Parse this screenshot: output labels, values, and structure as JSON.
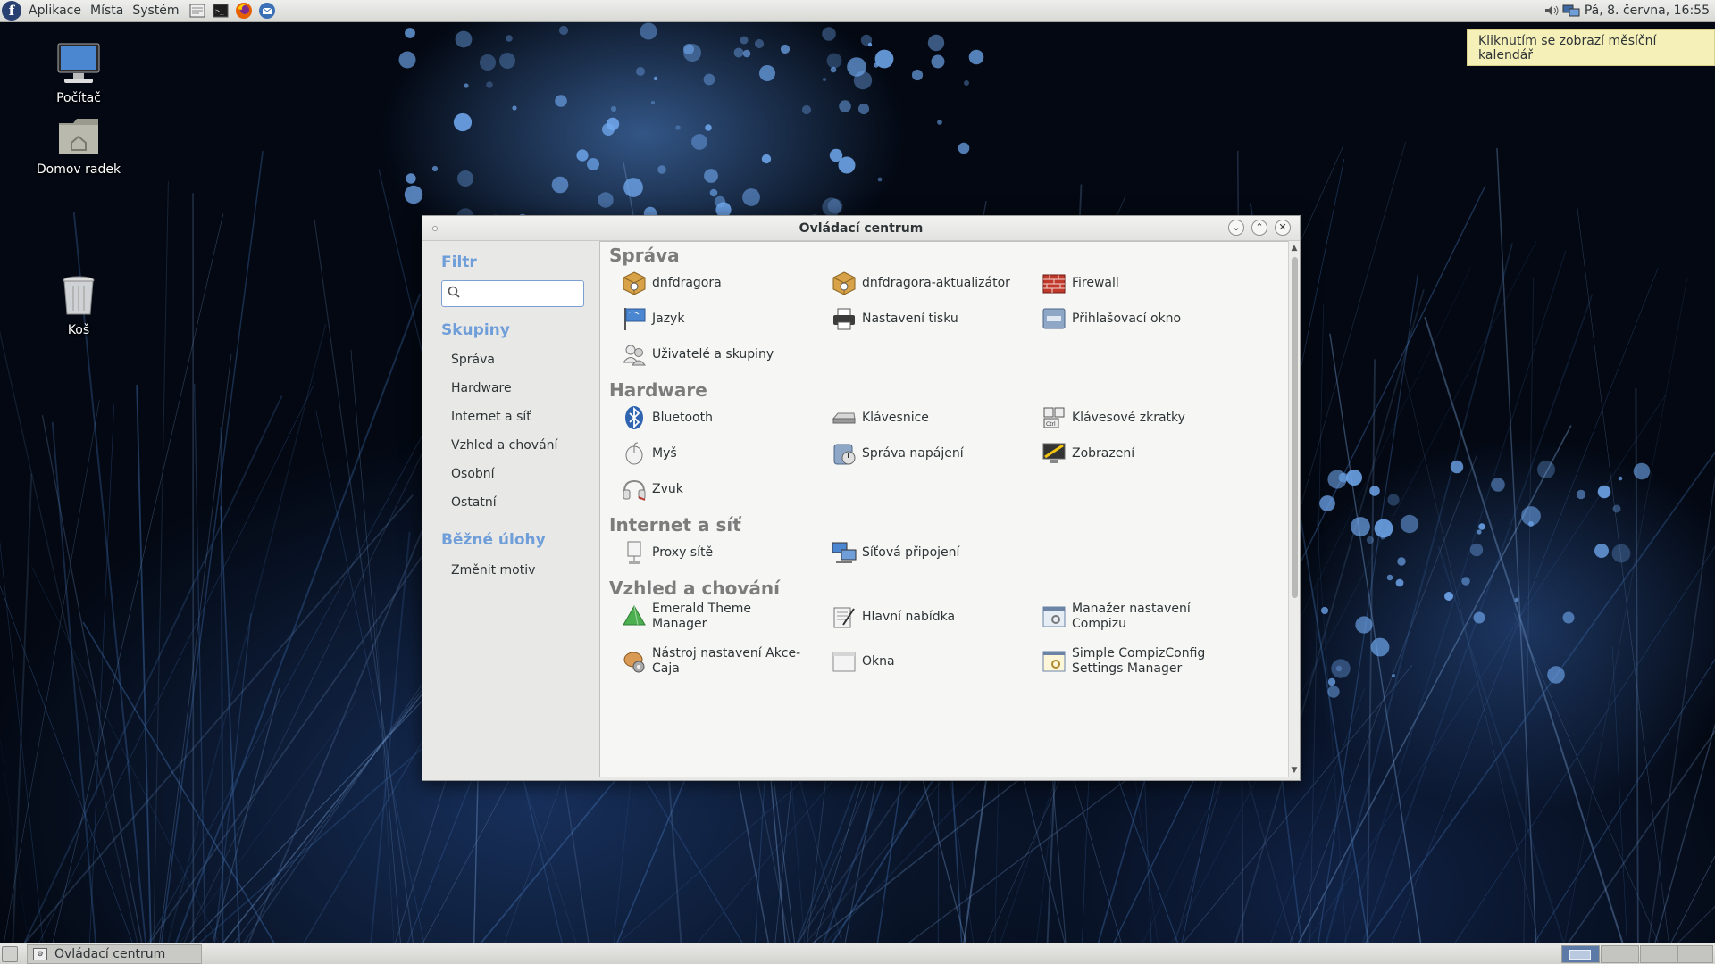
{
  "top_panel": {
    "menus": [
      "Aplikace",
      "Místa",
      "Systém"
    ],
    "clock": "Pá,  8. června, 16:55",
    "launchers": [
      "terminal-launcher",
      "firefox-launcher",
      "thunderbird-launcher"
    ]
  },
  "tooltip": {
    "text": "Kliknutím se zobrazí měsíční kalendář"
  },
  "desktop_icons": [
    {
      "label": "Počítač",
      "icon": "computer-icon"
    },
    {
      "label": "Domov radek",
      "icon": "home-folder-icon"
    },
    {
      "label": "Koš",
      "icon": "trash-icon"
    }
  ],
  "window": {
    "title": "Ovládací centrum",
    "sidebar": {
      "filter_heading": "Filtr",
      "search_value": "",
      "groups_heading": "Skupiny",
      "groups": [
        "Správa",
        "Hardware",
        "Internet a síť",
        "Vzhled a chování",
        "Osobní",
        "Ostatní"
      ],
      "tasks_heading": "Běžné úlohy",
      "tasks": [
        "Změnit motiv"
      ]
    },
    "sections": [
      {
        "title": "Správa",
        "items": [
          {
            "label": "dnfdragora",
            "icon": "package-icon"
          },
          {
            "label": "dnfdragora-aktualizátor",
            "icon": "package-update-icon"
          },
          {
            "label": "Firewall",
            "icon": "firewall-icon"
          },
          {
            "label": "Jazyk",
            "icon": "language-flag-icon"
          },
          {
            "label": "Nastavení tisku",
            "icon": "printer-icon"
          },
          {
            "label": "Přihlašovací okno",
            "icon": "login-window-icon"
          },
          {
            "label": "Uživatelé a skupiny",
            "icon": "users-icon"
          }
        ]
      },
      {
        "title": "Hardware",
        "items": [
          {
            "label": "Bluetooth",
            "icon": "bluetooth-icon"
          },
          {
            "label": "Klávesnice",
            "icon": "keyboard-icon"
          },
          {
            "label": "Klávesové zkratky",
            "icon": "keyboard-shortcuts-icon"
          },
          {
            "label": "Myš",
            "icon": "mouse-icon"
          },
          {
            "label": "Správa napájení",
            "icon": "power-management-icon"
          },
          {
            "label": "Zobrazení",
            "icon": "display-icon"
          },
          {
            "label": "Zvuk",
            "icon": "sound-icon"
          }
        ]
      },
      {
        "title": "Internet a síť",
        "items": [
          {
            "label": "Proxy sítě",
            "icon": "network-proxy-icon"
          },
          {
            "label": "Síťová připojení",
            "icon": "network-connections-icon"
          }
        ]
      },
      {
        "title": "Vzhled a chování",
        "items": [
          {
            "label": "Emerald Theme Manager",
            "icon": "emerald-icon"
          },
          {
            "label": "Hlavní nabídka",
            "icon": "main-menu-editor-icon"
          },
          {
            "label": "Manažer nastavení Compizu",
            "icon": "compiz-settings-icon"
          },
          {
            "label": "Nástroj nastavení Akce-Caja",
            "icon": "caja-actions-icon"
          },
          {
            "label": "Okna",
            "icon": "windows-icon"
          },
          {
            "label": "Simple CompizConfig Settings Manager",
            "icon": "simple-ccsm-icon"
          }
        ]
      }
    ]
  },
  "taskbar": {
    "tasks": [
      {
        "label": "Ovládací centrum"
      }
    ],
    "workspaces": 4,
    "active_workspace": 1
  },
  "colors": {
    "section_heading": "#7c7c7c",
    "sidebar_heading": "#6f9ed9",
    "tooltip_bg": "#f5f0b8"
  }
}
